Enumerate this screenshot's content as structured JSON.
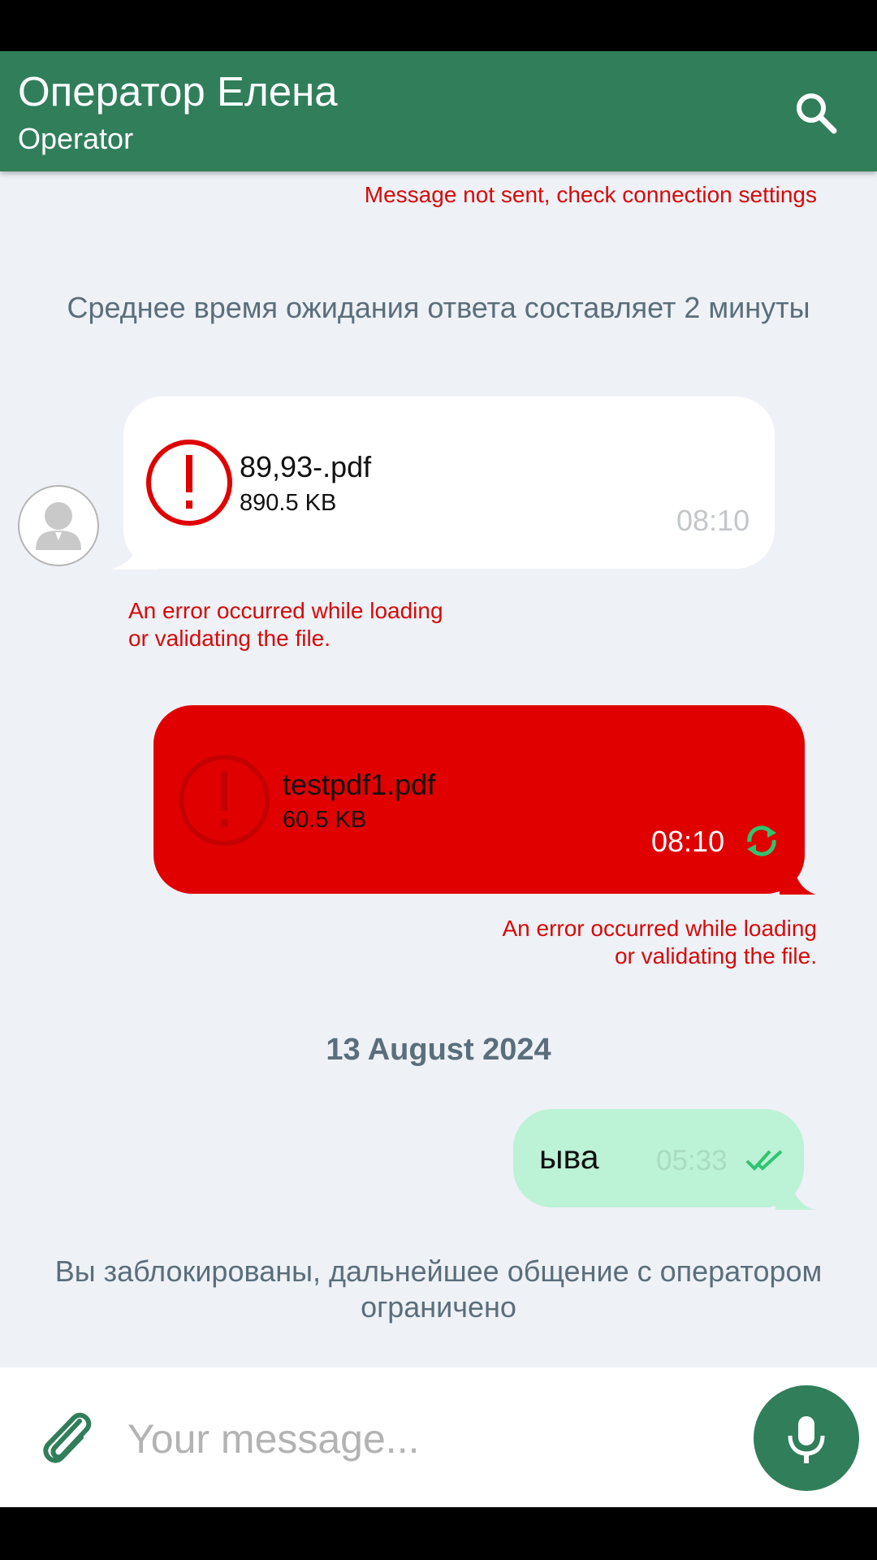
{
  "header": {
    "title": "Оператор Елена",
    "subtitle": "Operator",
    "search_icon": "search-icon"
  },
  "chat": {
    "send_error": "Message not sent, check connection settings",
    "wait_notice": "Среднее время ожидания ответа составляет 2 минуты",
    "incoming_file": {
      "name": "89,93-.pdf",
      "size": "890.5 KB",
      "time": "08:10",
      "error": "An error occurred while loading\nor validating the file."
    },
    "outgoing_file": {
      "name": "testpdf1.pdf",
      "size": "60.5 KB",
      "time": "08:10",
      "error": "An error occurred while loading\nor validating the file."
    },
    "date_divider": "13 August 2024",
    "outgoing_text": {
      "text": "ыва",
      "time": "05:33",
      "status_icon": "double-check-icon"
    },
    "blocked_notice": "Вы заблокированы, дальнейшее общение с оператором ограничено"
  },
  "composer": {
    "placeholder": "Your message...",
    "attach_icon": "paperclip-icon",
    "mic_icon": "microphone-icon"
  },
  "colors": {
    "primary": "#307f5a",
    "error": "#e00000",
    "outgoing_bubble": "#bcf2d5",
    "background": "#eef1f6"
  }
}
